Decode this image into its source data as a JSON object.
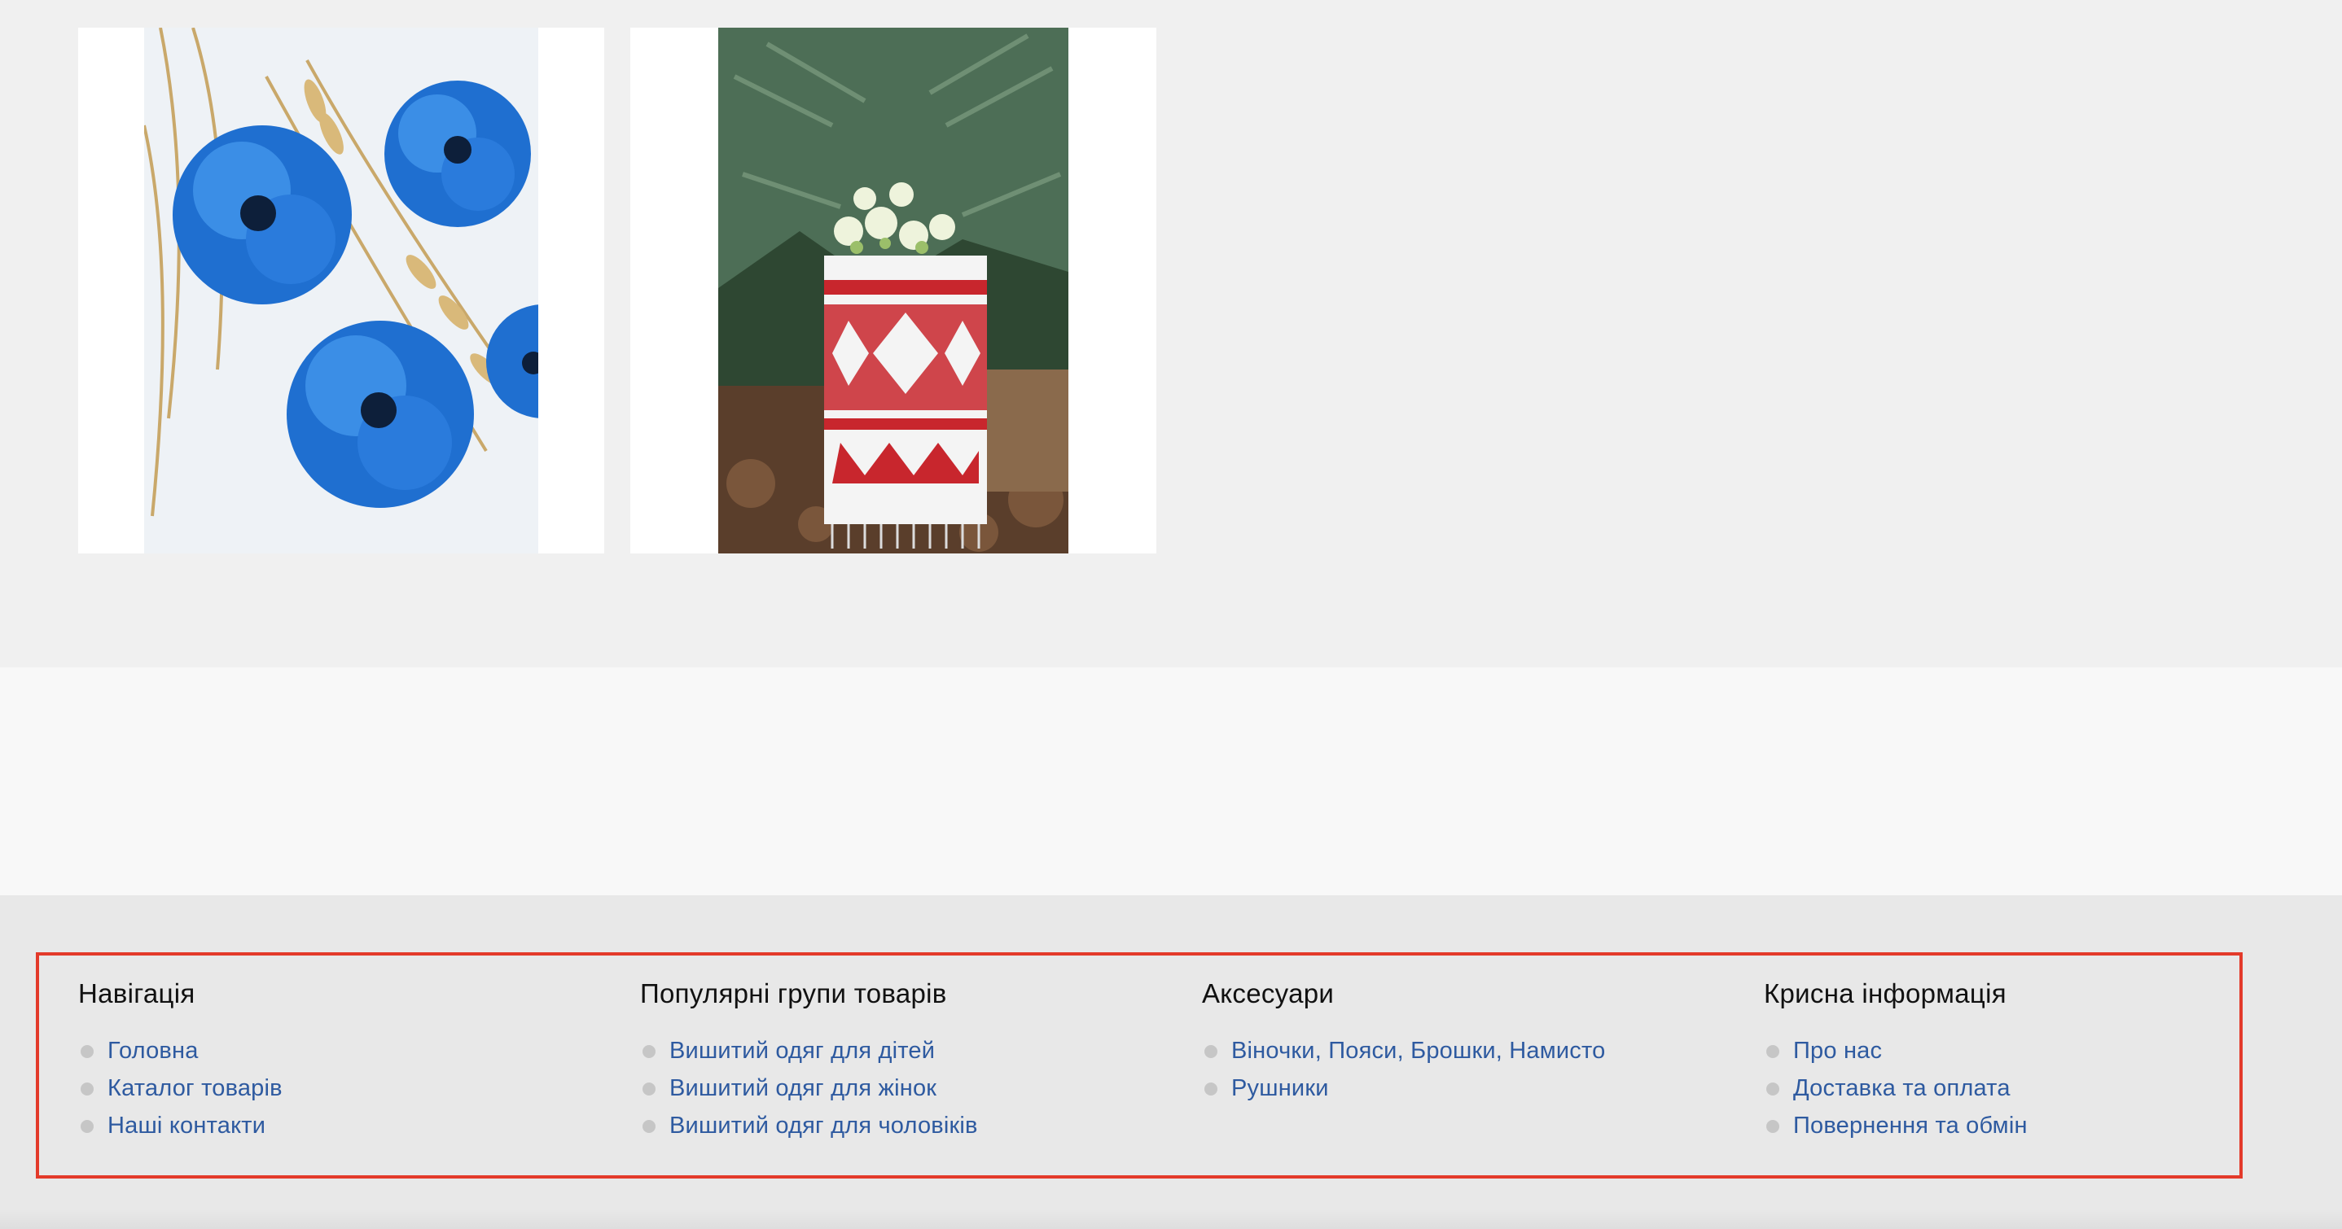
{
  "footer": {
    "columns": [
      {
        "title": "Навігація",
        "links": [
          "Головна",
          "Каталог товарів",
          "Наші контакти"
        ]
      },
      {
        "title": "Популярні групи товарів",
        "links": [
          "Вишитий одяг для дітей",
          "Вишитий одяг для жінок",
          "Вишитий одяг для чоловіків"
        ]
      },
      {
        "title": "Аксесуари",
        "links": [
          "Віночки, Пояси, Брошки, Намисто",
          "Рушники"
        ]
      },
      {
        "title": "Крисна інформація",
        "links": [
          "Про нас",
          "Доставка та оплата",
          "Повернення та обмін"
        ]
      }
    ]
  },
  "colors": {
    "page_bg": "#f0f0f0",
    "footer_bg": "#e8e8e8",
    "link": "#2e5aa0",
    "heading": "#111111",
    "highlight_border": "#e33a2a",
    "bullet": "#c6c6c6"
  }
}
